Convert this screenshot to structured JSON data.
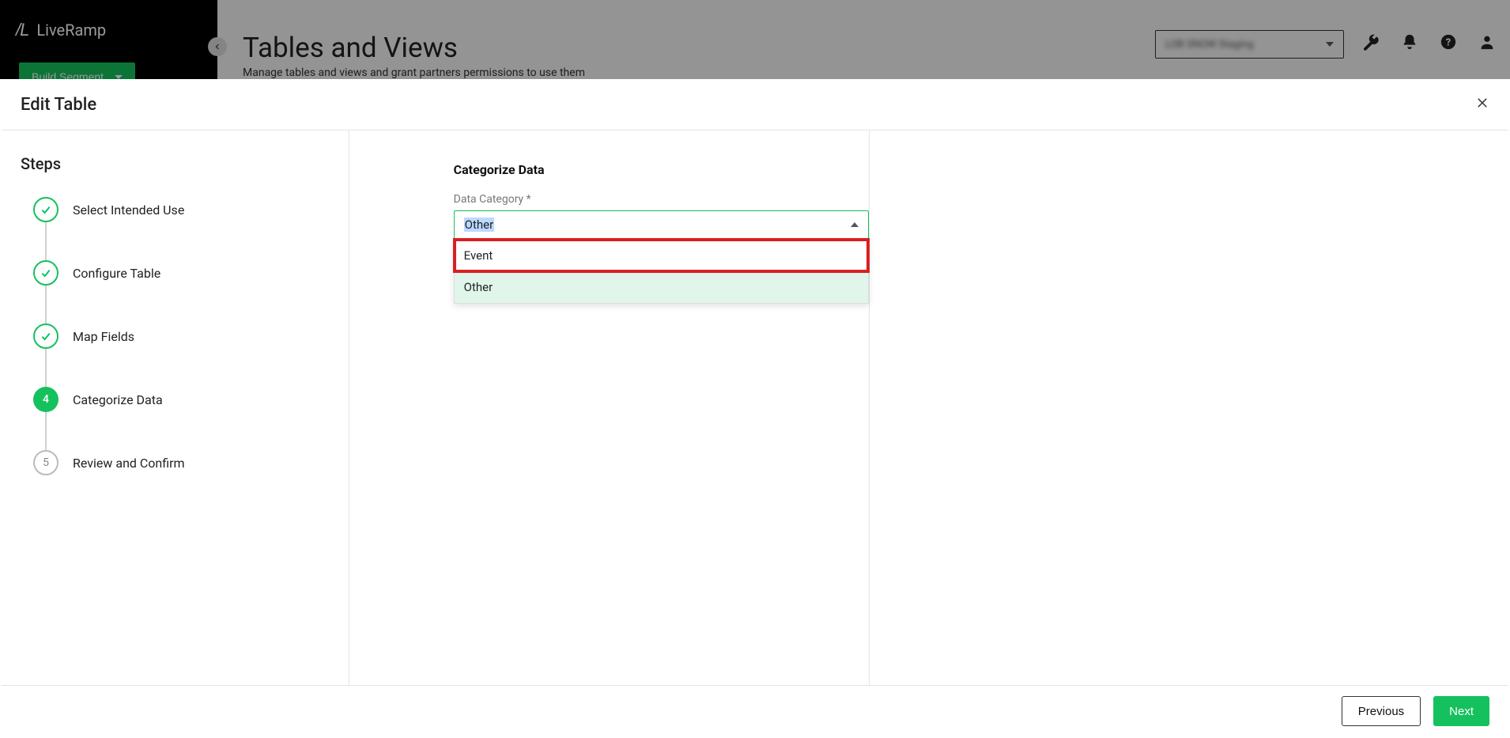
{
  "brand": {
    "name": "LiveRamp",
    "logomark": "/L"
  },
  "bg": {
    "build_segment": "Build Segment",
    "page_title": "Tables and Views",
    "page_subtitle": "Manage tables and views and grant partners permissions to use them",
    "org_blurred": "LOB SNOW Staging"
  },
  "modal": {
    "title": "Edit Table",
    "steps_heading": "Steps",
    "steps": [
      {
        "label": "Select Intended Use",
        "state": "done"
      },
      {
        "label": "Configure Table",
        "state": "done"
      },
      {
        "label": "Map Fields",
        "state": "done"
      },
      {
        "label": "Categorize Data",
        "state": "active",
        "number": "4"
      },
      {
        "label": "Review and Confirm",
        "state": "pending",
        "number": "5"
      }
    ],
    "form": {
      "section_title": "Categorize Data",
      "field_label": "Data Category *",
      "selected_value": "Other",
      "options": [
        {
          "label": "Event",
          "highlighted": true
        },
        {
          "label": "Other",
          "selected": true
        }
      ]
    },
    "footer": {
      "previous": "Previous",
      "next": "Next"
    }
  }
}
